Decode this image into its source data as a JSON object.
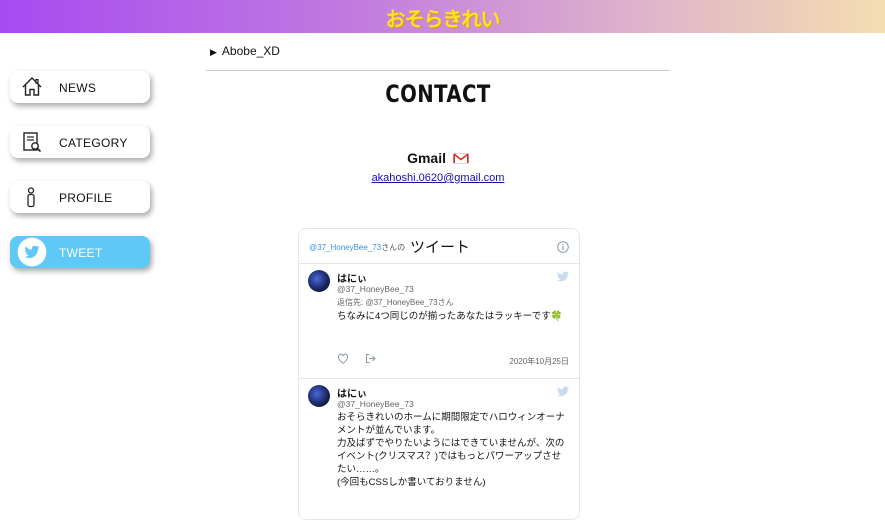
{
  "header": {
    "logo_text": "おそらきれい"
  },
  "sidebar": {
    "items": [
      {
        "label": "NEWS",
        "icon": "home-icon",
        "active": false
      },
      {
        "label": "CATEGORY",
        "icon": "document-search-icon",
        "active": false
      },
      {
        "label": "PROFILE",
        "icon": "person-icon",
        "active": false
      },
      {
        "label": "TWEET",
        "icon": "twitter-bird-icon",
        "active": true
      }
    ],
    "active_color": "#5ec8f6"
  },
  "main": {
    "breadcrumb": "Abobe_XD",
    "title": "CONTACT",
    "gmail_heading": "Gmail",
    "email": "akahoshi.0620@gmail.com"
  },
  "twitter": {
    "header_handle": "@37_HoneyBee_73",
    "header_suffix": "さんの",
    "header_title": "ツイート",
    "tweets": [
      {
        "name": "はにぃ",
        "handle": "@37_HoneyBee_73",
        "reply_to": "返信先: @37_HoneyBee_73さん",
        "text": "ちなみに4つ同じのが揃ったあなたはラッキーです🍀",
        "date": "2020年10月25日"
      },
      {
        "name": "はにぃ",
        "handle": "@37_HoneyBee_73",
        "text": "おそらきれいのホームに期間限定でハロウィンオーナメントが並んでいます。\n力及ばずでやりたいようにはできていませんが、次のイベント(クリスマス？)ではもっとパワーアップさせたい……。\n(今回もCSSしか書いておりません)"
      }
    ]
  }
}
